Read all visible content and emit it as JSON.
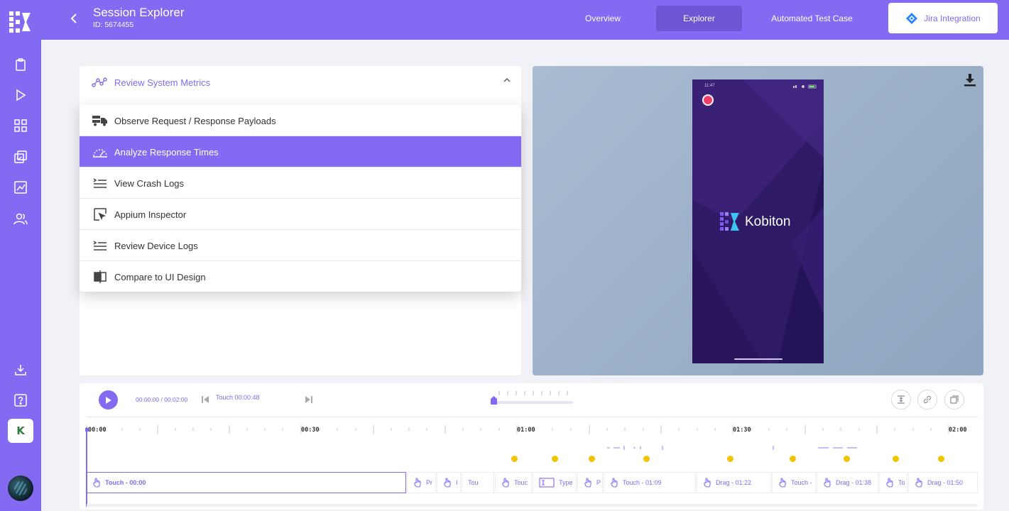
{
  "header": {
    "title": "Session Explorer",
    "session_id": "ID: 5674455",
    "tabs": [
      {
        "label": "Overview",
        "active": false
      },
      {
        "label": "Explorer",
        "active": true
      },
      {
        "label": "Automated Test Case",
        "active": false
      }
    ],
    "jira_label": "Jira Integration"
  },
  "sidebar": {
    "icons": [
      "clipboard-icon",
      "play-icon",
      "grid-icon",
      "layers-icon",
      "chart-icon",
      "users-icon",
      "download-icon",
      "help-icon"
    ],
    "org_badge": "K"
  },
  "metrics": {
    "header_label": "Review System Metrics",
    "items": [
      {
        "label": "Observe Request / Response Payloads",
        "icon": "truck-icon",
        "selected": false
      },
      {
        "label": "Analyze Response Times",
        "icon": "gauge-icon",
        "selected": true
      },
      {
        "label": "View Crash Logs",
        "icon": "list-icon",
        "selected": false
      },
      {
        "label": "Appium Inspector",
        "icon": "cursor-icon",
        "selected": false
      },
      {
        "label": "Review Device Logs",
        "icon": "list-icon",
        "selected": false
      },
      {
        "label": "Compare to UI Design",
        "icon": "compare-icon",
        "selected": false
      }
    ]
  },
  "device": {
    "status_time": "11:47",
    "brand": "Kobiton"
  },
  "player": {
    "time": "00:00:00 / 00:02:00",
    "current_action": "Touch 00:00:48",
    "ruler": [
      "00:00",
      "00:30",
      "01:00",
      "01:30",
      "02:00"
    ],
    "events": [
      {
        "label": "Touch - 00:00"
      },
      {
        "label": "Pr"
      },
      {
        "label": "I"
      },
      {
        "label": "Tou"
      },
      {
        "label": "Touc"
      },
      {
        "label": "Type"
      },
      {
        "label": "P"
      },
      {
        "label": "Touch - 01:09"
      },
      {
        "label": "Drag - 01:22"
      },
      {
        "label": "Touch -"
      },
      {
        "label": "Drag - 01:38"
      },
      {
        "label": "To"
      },
      {
        "label": "Drag - 01:50"
      }
    ]
  },
  "colors": {
    "brand": "#8469f2",
    "brand_dark": "#6e55d4",
    "marker": "#f2c300",
    "record": "#f23c6a"
  }
}
